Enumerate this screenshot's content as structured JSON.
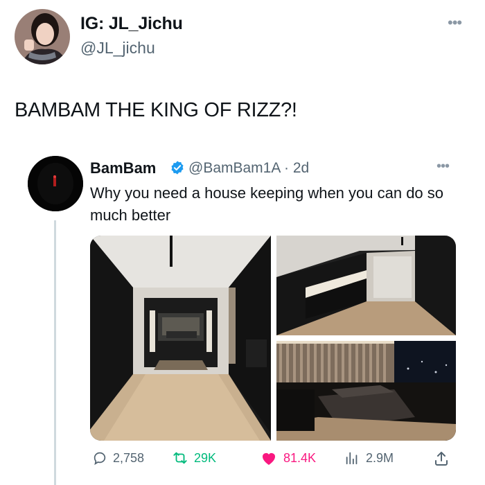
{
  "author": {
    "display_name": "IG: JL_Jichu",
    "handle": "@JL_jichu"
  },
  "tweet": {
    "text": "BAMBAM THE KING OF RIZZ?!"
  },
  "quoted": {
    "display_name": "BamBam",
    "handle_meta": "@BamBam1A · 2d",
    "text": "Why you need a house keeping when you can do so much better",
    "verified_color": "#1d9bf0"
  },
  "media": [
    {
      "label": "photo-hallway"
    },
    {
      "label": "photo-kitchen"
    },
    {
      "label": "photo-bedroom"
    }
  ],
  "actions": {
    "replies": "2,758",
    "retweets": "29K",
    "likes": "81.4K",
    "views": "2.9M"
  },
  "colors": {
    "retweet": "#00ba7c",
    "like": "#f91880",
    "muted": "#536471"
  },
  "icons": [
    "more-icon",
    "verified-badge-icon",
    "reply-icon",
    "retweet-icon",
    "like-icon",
    "views-icon",
    "share-icon"
  ]
}
